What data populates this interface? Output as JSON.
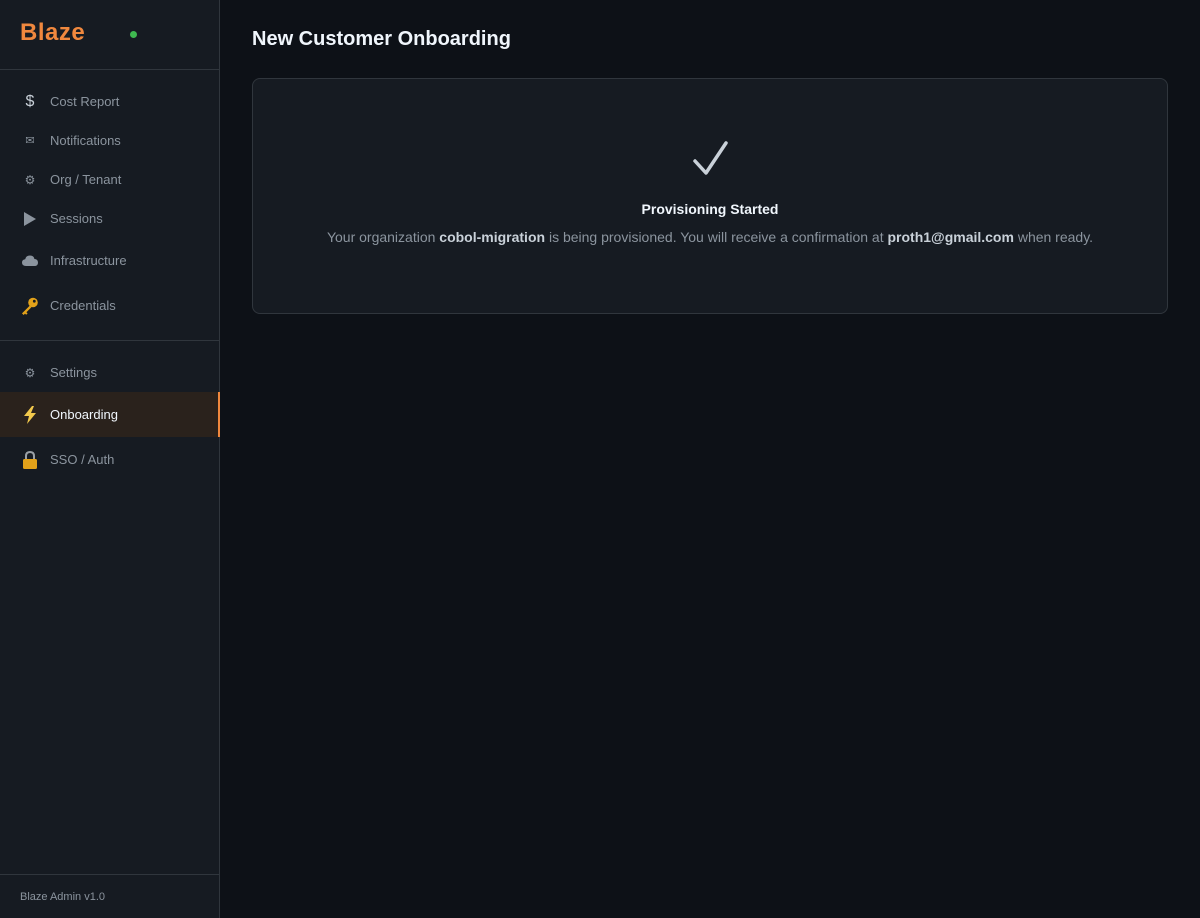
{
  "app": {
    "name": "Blaze",
    "status_color": "#3fb950",
    "accent_color": "#f0883e"
  },
  "sidebar": {
    "primary_items": [
      {
        "label": "Cost Report",
        "icon": "dollar-icon"
      },
      {
        "label": "Notifications",
        "icon": "envelope-icon"
      },
      {
        "label": "Org / Tenant",
        "icon": "gear-icon"
      },
      {
        "label": "Sessions",
        "icon": "play-icon"
      },
      {
        "label": "Infrastructure",
        "icon": "cloud-icon"
      },
      {
        "label": "Credentials",
        "icon": "key-icon"
      }
    ],
    "secondary_items": [
      {
        "label": "Settings",
        "icon": "gear-icon"
      },
      {
        "label": "Onboarding",
        "icon": "lightning-icon",
        "active": true
      },
      {
        "label": "SSO / Auth",
        "icon": "lock-icon"
      }
    ],
    "footer": "Blaze Admin v1.0"
  },
  "main": {
    "title": "New Customer Onboarding",
    "card": {
      "icon": "checkmark-icon",
      "title": "Provisioning Started",
      "message_prefix": "Your organization ",
      "org_name": "cobol-migration",
      "message_middle": " is being provisioned. You will receive a confirmation at ",
      "email": "proth1@gmail.com",
      "message_suffix": " when ready."
    }
  }
}
